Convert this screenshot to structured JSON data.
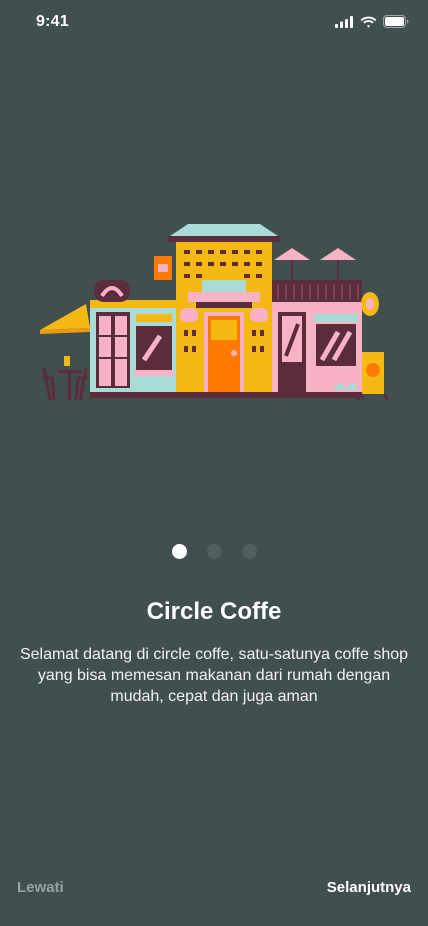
{
  "status": {
    "time": "9:41"
  },
  "onboarding": {
    "title": "Circle Coffe",
    "description": "Selamat datang di circle coffe, satu-satunya coffe shop yang bisa memesan makanan dari rumah dengan mudah, cepat dan juga aman",
    "current_page": 1,
    "total_pages": 3
  },
  "footer": {
    "skip_label": "Lewati",
    "next_label": "Selanjutnya"
  },
  "colors": {
    "background": "#414f4f",
    "accent_yellow": "#f5b914",
    "accent_orange": "#ff7a00",
    "pink": "#f7b3c5",
    "teal": "#a9dcd6"
  },
  "icons": [
    "cellular-signal-icon",
    "wifi-icon",
    "battery-icon"
  ]
}
